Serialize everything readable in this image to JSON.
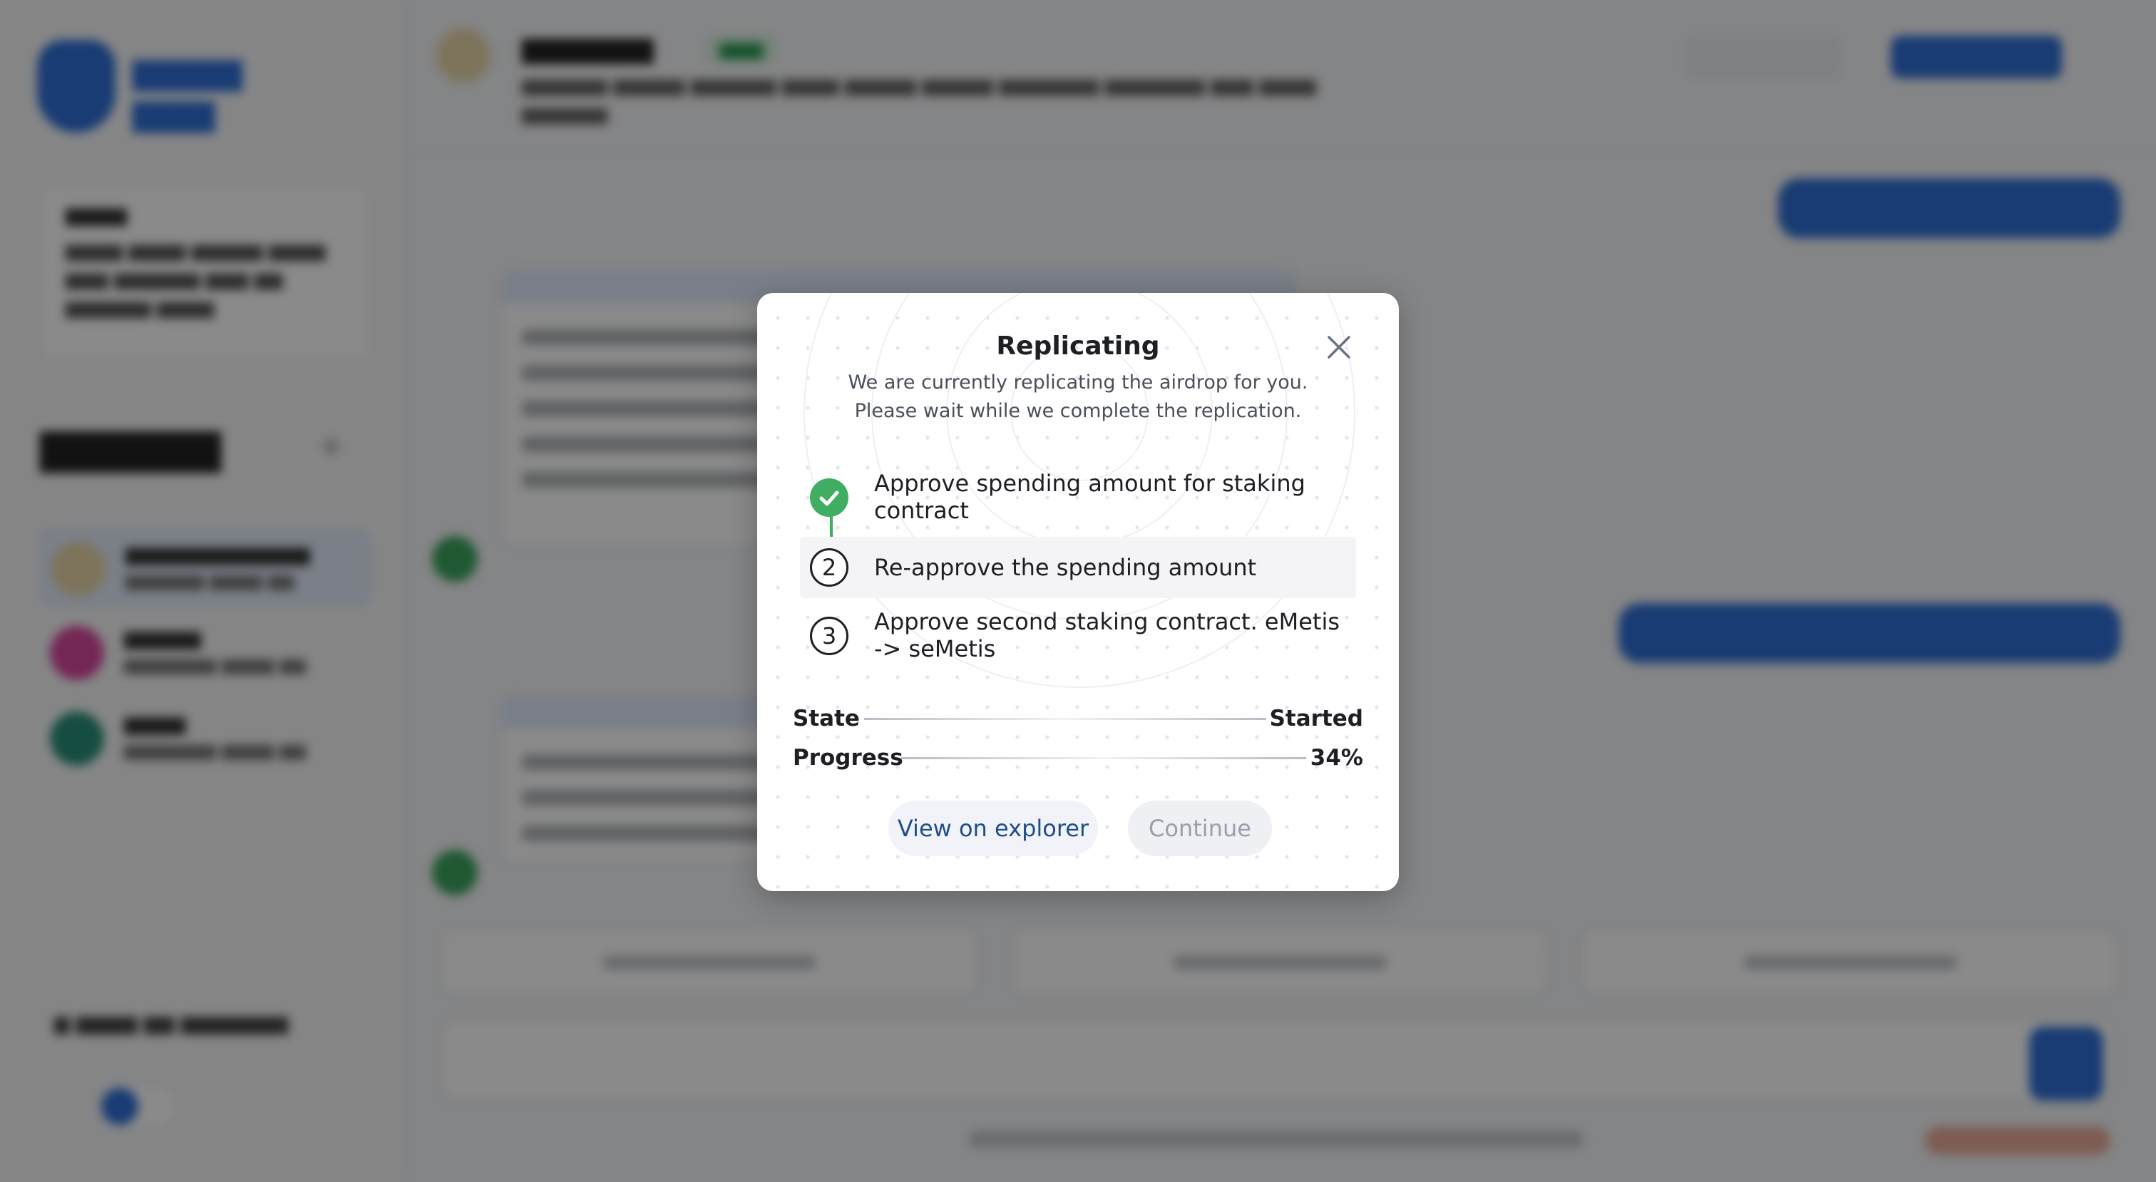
{
  "modal": {
    "title": "Replicating",
    "subtitle_line1": "We are currently replicating the airdrop for you.",
    "subtitle_line2": "Please wait while we complete the replication.",
    "steps": [
      {
        "label": "Approve spending amount for staking contract",
        "status": "completed",
        "icon": "check-icon"
      },
      {
        "number": "2",
        "label": "Re-approve the spending amount",
        "status": "current"
      },
      {
        "number": "3",
        "label": "Approve second staking contract. eMetis -> seMetis",
        "status": "pending"
      }
    ],
    "state": {
      "label": "State",
      "value": "Started"
    },
    "progress": {
      "label": "Progress",
      "value": "34%",
      "fraction": 0.34
    },
    "explorer_button": "View on explorer",
    "continue_button": "Continue"
  },
  "colors": {
    "success": "#3fae63",
    "link": "#1f4e8a",
    "disabled": "#9aa0aa",
    "overlay": "rgba(0,0,0,0.46)",
    "brand": "#2f6fd6"
  }
}
